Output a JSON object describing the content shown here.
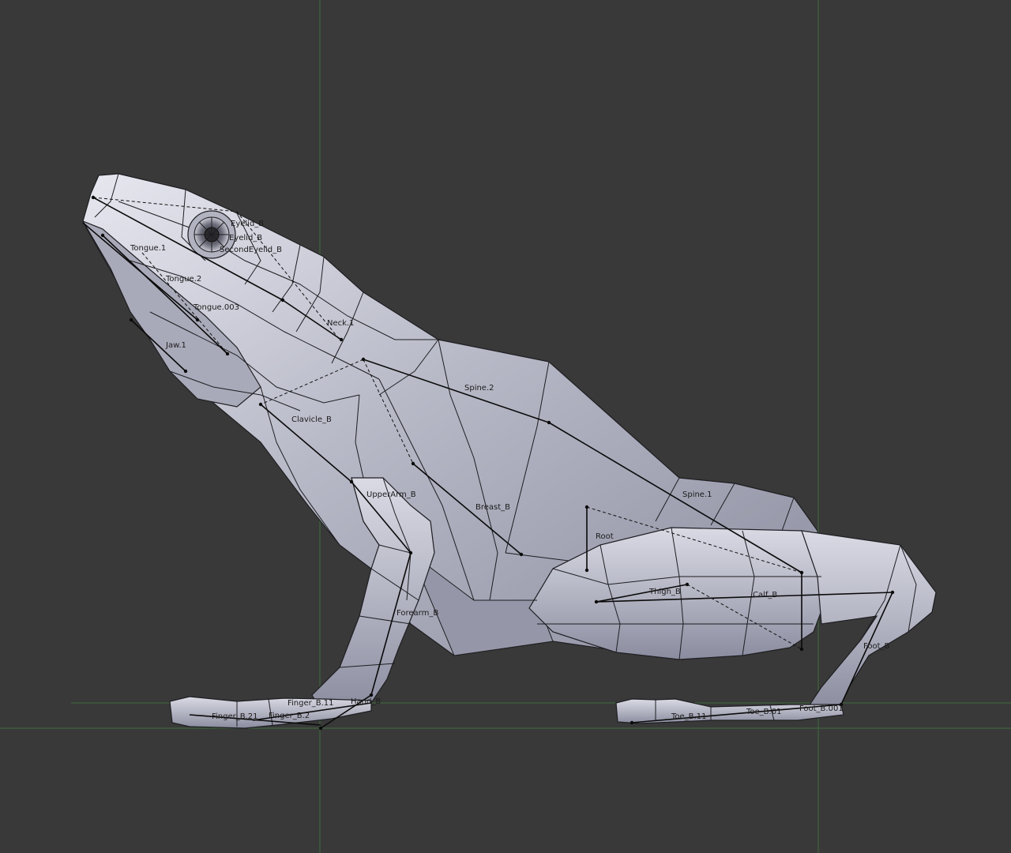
{
  "viewport": {
    "background": "#393939",
    "grid_color": "#3f6b3f",
    "mesh_fill": "#b9bac6",
    "mesh_shadow": "#8f91a2",
    "mesh_highlight": "#e4e5ee"
  },
  "bones": {
    "tongue_1": "Tongue.1",
    "tongue_2": "Tongue.2",
    "tongue_003": "Tongue.003",
    "neck_1": "Neck.1",
    "spine_2": "Spine.2",
    "clavicle_b": "Clavicle_B",
    "upperarm_b": "UpperArm_B",
    "breast_b": "Breast_B",
    "spine_1": "Spine.1",
    "root": "Root",
    "thigh_b": "Thigh_B",
    "calf_b": "Calf_B",
    "forearm_b": "Forearm_B",
    "foot_b": "Foot_B",
    "foot_b_001": "Foot_B.001",
    "second_eyelid_b": "SecondEyelid_B",
    "eye_top": "Eyelid_B",
    "eye_lower": "Eyelid_B",
    "jaw_label": "Jaw.1",
    "hand_b": "Hand_B",
    "finger_b_11": "Finger_B.11",
    "finger_b_21": "Finger_B.21",
    "finger_b_2": "Finger_B.2",
    "toe_b_01": "Toe_B.01",
    "toe_b_11": "Toe_B.11"
  }
}
